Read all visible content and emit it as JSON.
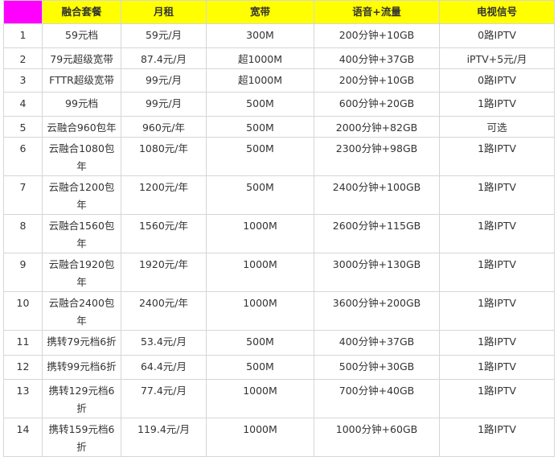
{
  "header": {
    "col0": "",
    "col1": "融合套餐",
    "col2": "月租",
    "col3": "宽带",
    "col4": "语音+流量",
    "col5": "电视信号"
  },
  "rows": [
    {
      "no": "1",
      "plan": "59元档",
      "fee": "59元/月",
      "bw": "300M",
      "data": "200分钟+10GB",
      "tv": "0路IPTV"
    },
    {
      "no": "2",
      "plan": "79元超级宽带",
      "fee": "87.4元/月",
      "bw": "超1000M",
      "data": "400分钟+37GB",
      "tv": "iPTV+5元/月"
    },
    {
      "no": "3",
      "plan": "FTTR超级宽带",
      "fee": "99元/月",
      "bw": "超1000M",
      "data": "200分钟+10GB",
      "tv": "0路IPTV"
    },
    {
      "no": "4",
      "plan": "99元档",
      "fee": "99元/月",
      "bw": "500M",
      "data": "600分钟+20GB",
      "tv": "1路IPTV"
    },
    {
      "no": "5",
      "plan": "云融合960包年",
      "fee": "960元/年",
      "bw": "500M",
      "data": "2000分钟+82GB",
      "tv": "可选"
    },
    {
      "no": "6",
      "plan": "云融合1080包年",
      "fee": "1080元/年",
      "bw": "500M",
      "data": "2300分钟+98GB",
      "tv": "1路IPTV"
    },
    {
      "no": "7",
      "plan": "云融合1200包年",
      "fee": "1200元/年",
      "bw": "500M",
      "data": "2400分钟+100GB",
      "tv": "1路IPTV"
    },
    {
      "no": "8",
      "plan": "云融合1560包年",
      "fee": "1560元/年",
      "bw": "1000M",
      "data": "2600分钟+115GB",
      "tv": "1路IPTV"
    },
    {
      "no": "9",
      "plan": "云融合1920包年",
      "fee": "1920元/年",
      "bw": "1000M",
      "data": "3000分钟+130GB",
      "tv": "1路IPTV"
    },
    {
      "no": "10",
      "plan": "云融合2400包年",
      "fee": "2400元/年",
      "bw": "1000M",
      "data": "3600分钟+200GB",
      "tv": "1路IPTV"
    },
    {
      "no": "11",
      "plan": "携转79元档6折",
      "fee": "53.4元/月",
      "bw": "500M",
      "data": "400分钟+37GB",
      "tv": "1路IPTV"
    },
    {
      "no": "12",
      "plan": "携转99元档6折",
      "fee": "64.4元/月",
      "bw": "500M",
      "data": "500分钟+30GB",
      "tv": "1路IPTV"
    },
    {
      "no": "13",
      "plan": "携转129元档6折",
      "fee": "77.4元/月",
      "bw": "1000M",
      "data": "700分钟+40GB",
      "tv": "1路IPTV"
    },
    {
      "no": "14",
      "plan": "携转159元档6折",
      "fee": "119.4元/月",
      "bw": "1000M",
      "data": "1000分钟+60GB",
      "tv": "1路IPTV"
    }
  ]
}
